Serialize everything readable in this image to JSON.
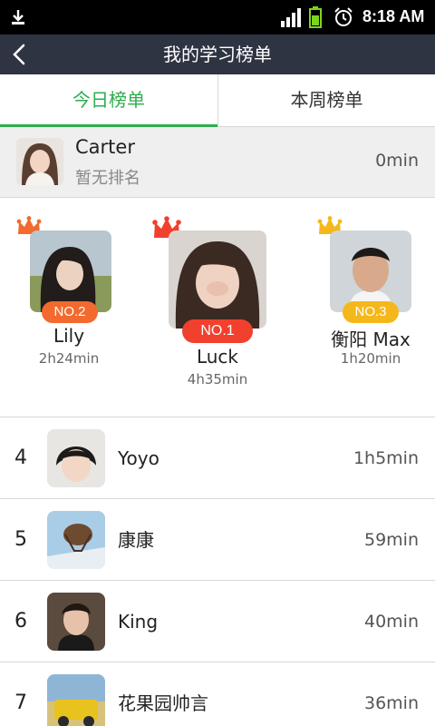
{
  "status_bar": {
    "time": "8:18 AM",
    "icons": [
      "download-icon",
      "signal-icon",
      "battery-icon",
      "alarm-icon"
    ]
  },
  "header": {
    "title": "我的学习榜单",
    "back_icon": "back-arrow-icon"
  },
  "tabs": [
    {
      "label": "今日榜单",
      "active": true
    },
    {
      "label": "本周榜单",
      "active": false
    }
  ],
  "me": {
    "name": "Carter",
    "rank_text": "暂无排名",
    "time": "0min"
  },
  "podium": {
    "first": {
      "badge": "NO.1",
      "name": "Luck",
      "time": "4h35min"
    },
    "second": {
      "badge": "NO.2",
      "name": "Lily",
      "time": "2h24min"
    },
    "third": {
      "badge": "NO.3",
      "name": "衡阳 Max",
      "time": "1h20min"
    }
  },
  "list": [
    {
      "rank": "4",
      "name": "Yoyo",
      "time": "1h5min"
    },
    {
      "rank": "5",
      "name": "康康",
      "time": "59min"
    },
    {
      "rank": "6",
      "name": "King",
      "time": "40min"
    },
    {
      "rank": "7",
      "name": "花果园帅言",
      "time": "36min"
    }
  ],
  "colors": {
    "accent_green": "#2ead4d",
    "no1": "#f2402e",
    "no2": "#f26a2e",
    "no3": "#f5b81c",
    "titlebar": "#2f3442"
  }
}
